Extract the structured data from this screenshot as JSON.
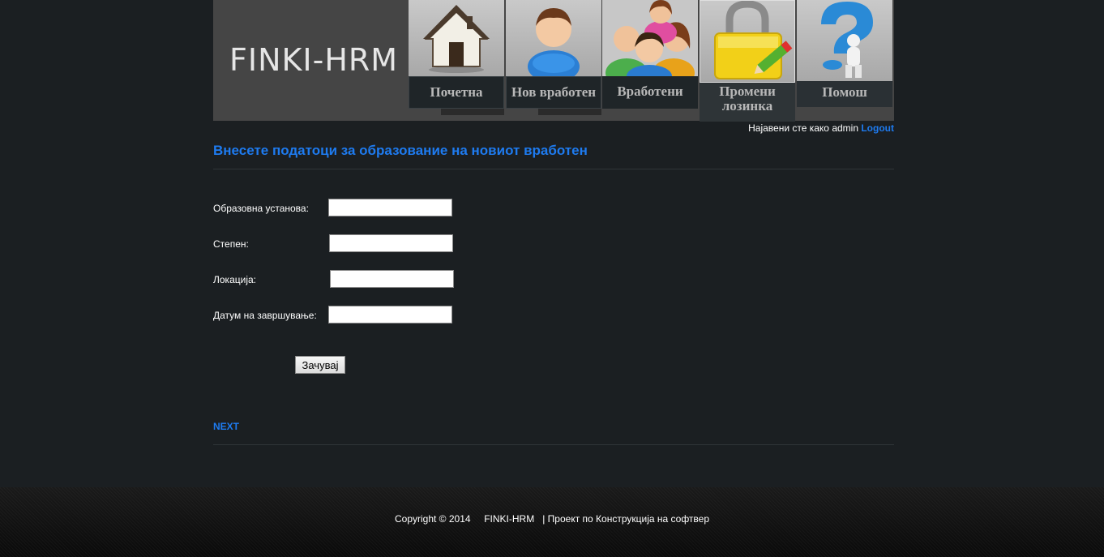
{
  "header": {
    "logo": "FINKI-HRM",
    "nav": [
      {
        "label": "Почетна",
        "icon": "house-icon"
      },
      {
        "label": "Нов вработен",
        "icon": "new-employee-icon"
      },
      {
        "label": "Вработени",
        "icon": "employees-icon"
      },
      {
        "label": "Промени лозинка",
        "icon": "lock-pencil-icon"
      },
      {
        "label": "Помош",
        "icon": "help-question-icon"
      }
    ]
  },
  "user": {
    "prefix": "Најавени сте како admin",
    "logout": "Logout"
  },
  "page": {
    "title": "Внесете податоци за образование на новиот вработен"
  },
  "form": {
    "fields": [
      {
        "label": "Образовна установа:",
        "value": ""
      },
      {
        "label": "Степен:",
        "value": ""
      },
      {
        "label": "Локација:",
        "value": ""
      },
      {
        "label": "Датум на завршување:",
        "value": ""
      }
    ],
    "save_label": "Зачувај",
    "next_label": "NEXT"
  },
  "footer": {
    "copyright": "Copyright © 2014",
    "brand": "FINKI-HRM",
    "project": "| Проект по Конструкција на софтвер"
  },
  "colors": {
    "accent": "#1e7bf0",
    "background": "#1b1f22",
    "header": "#454545"
  }
}
